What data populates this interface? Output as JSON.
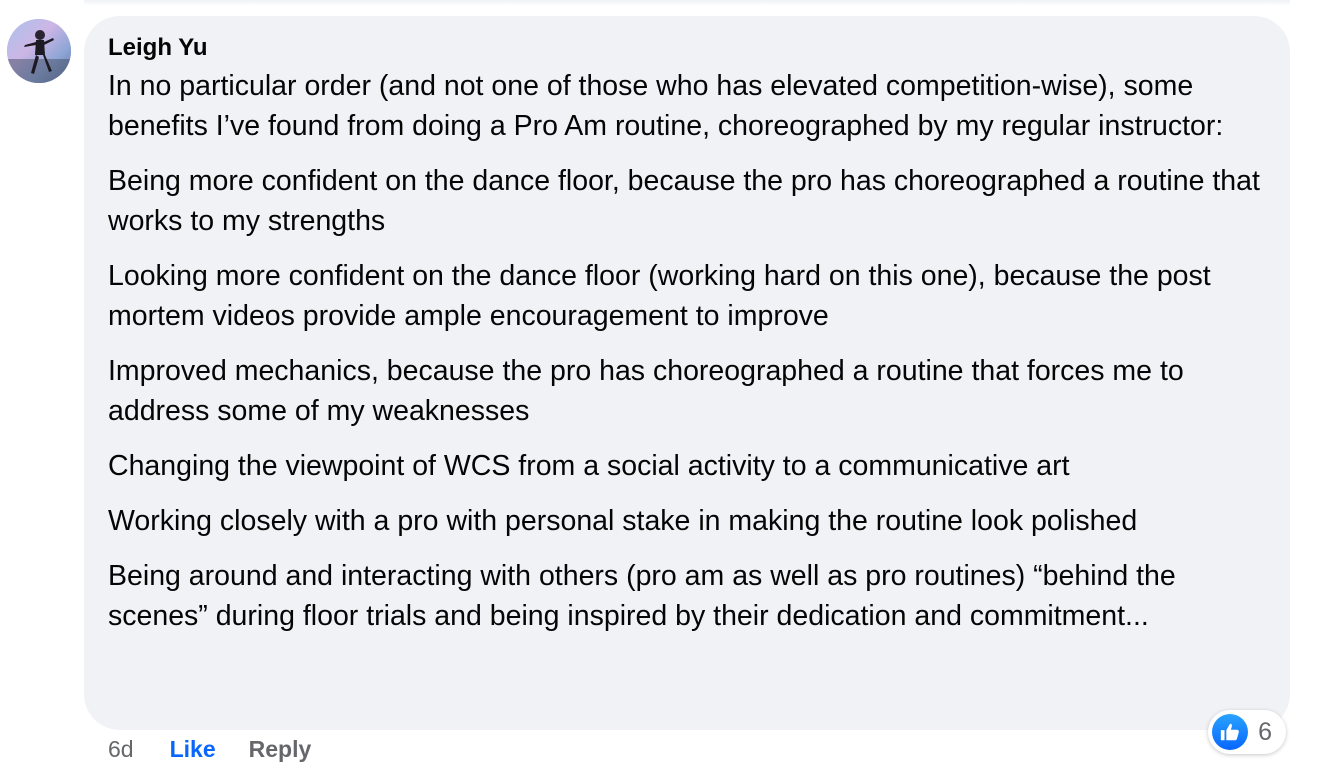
{
  "comment": {
    "author": "Leigh Yu",
    "paragraphs": [
      "In no particular order (and not one of those who has elevated competition-wise), some benefits I’ve found from doing a Pro Am routine, choreographed by my regular instructor:",
      "Being more confident on the dance floor, because the pro has choreographed a routine that works to my strengths",
      "Looking more confident on the dance floor (working hard on this one), because the post mortem videos provide ample encouragement to improve",
      "Improved mechanics, because the pro has choreographed a routine that forces me to address some of my weaknesses",
      "Changing the viewpoint of WCS from a social activity to a communicative art",
      "Working closely with a pro with personal stake in making the routine look polished",
      "Being around and interacting with others (pro am as well as pro routines) “behind the scenes” during floor trials and being inspired by their dedication and commitment..."
    ],
    "reaction_icon": "like-icon",
    "reaction_count": "6"
  },
  "actions": {
    "time": "6d",
    "like_label": "Like",
    "reply_label": "Reply"
  },
  "colors": {
    "bubble_bg": "#f0f2f5",
    "link_blue": "#0866ff",
    "muted": "#65676b"
  }
}
